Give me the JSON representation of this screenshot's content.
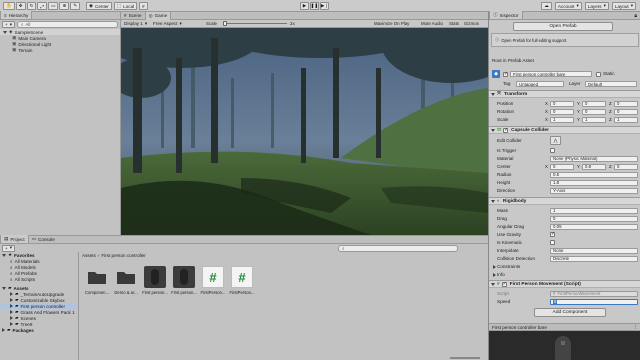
{
  "toolbar": {
    "pivot": "Center",
    "space": "Local",
    "account": "Account",
    "layers": "Layers",
    "layout": "Layout"
  },
  "hierarchy": {
    "tab": "Hierarchy",
    "search_placeholder": "All",
    "scene": "SampleScene",
    "items": [
      "Main Camera",
      "Directional Light",
      "Terrain"
    ]
  },
  "game": {
    "tabs": [
      "Scene",
      "Game"
    ],
    "display": "Display 1",
    "aspect": "Free Aspect",
    "scale_label": "Scale",
    "scale_value": "2x",
    "options": [
      "Maximize On Play",
      "Mute Audio",
      "Stats",
      "Gizmos"
    ]
  },
  "inspector": {
    "tab": "Inspector",
    "open_prefab": "Open Prefab",
    "open_prefab_hint": "Open Prefab for full editing support.",
    "root_label": "Root in Prefab Asset",
    "object_name": "First person controller bare",
    "static_label": "Static",
    "tag_label": "Tag",
    "tag_value": "Untagged",
    "layer_label": "Layer",
    "layer_value": "Default",
    "transform": {
      "title": "Transform",
      "rows": [
        {
          "label": "Position",
          "x": "0",
          "y": "0",
          "z": "0"
        },
        {
          "label": "Rotation",
          "x": "0",
          "y": "0",
          "z": "0"
        },
        {
          "label": "Scale",
          "x": "1",
          "y": "1",
          "z": "1"
        }
      ]
    },
    "capsule": {
      "title": "Capsule Collider",
      "edit_collider": "Edit Collider",
      "is_trigger": "Is Trigger",
      "material_label": "Material",
      "material_value": "None (Physic Material)",
      "center_label": "Center",
      "center": {
        "x": "0",
        "y": "0.9",
        "z": "0"
      },
      "radius_label": "Radius",
      "radius": "0.5",
      "height_label": "Height",
      "height": "1.8",
      "direction_label": "Direction",
      "direction": "Y-Axis"
    },
    "rigidbody": {
      "title": "Rigidbody",
      "mass_label": "Mass",
      "mass": "1",
      "drag_label": "Drag",
      "drag": "0",
      "angular_label": "Angular Drag",
      "angular": "0.05",
      "gravity_label": "Use Gravity",
      "kinematic_label": "Is Kinematic",
      "interpolate_label": "Interpolate",
      "interpolate": "None",
      "collision_label": "Collision Detection",
      "collision": "Discrete",
      "constraints": "Constraints",
      "info": "Info"
    },
    "movement": {
      "title": "First Person Movement (Script)",
      "script_label": "Script",
      "script_value": "FirstPersonMovement",
      "speed_label": "Speed",
      "speed_value": "5"
    },
    "add_component": "Add Component",
    "preview_title": "First person controller bare"
  },
  "project": {
    "tabs": [
      "Project",
      "Console"
    ],
    "breadcrumb": [
      "Assets",
      "First person controller"
    ],
    "favorites_label": "Favorites",
    "favorites": [
      "All Materials",
      "All Models",
      "All Prefabs",
      "All Scripts"
    ],
    "assets_label": "Assets",
    "folders": [
      "_TerrainAutoUpgrade",
      "Customizable Skybox",
      "First person controller",
      "Grass And Flowers Pack 1",
      "Scenes",
      "Tree9"
    ],
    "packages_label": "Packages",
    "items": [
      {
        "name": "Componen...",
        "kind": "folder"
      },
      {
        "name": "Demo & ar...",
        "kind": "folder"
      },
      {
        "name": "First person...",
        "kind": "capsule"
      },
      {
        "name": "First person...",
        "kind": "capsule"
      },
      {
        "name": "FirstPerson...",
        "kind": "script"
      },
      {
        "name": "FirstPerson...",
        "kind": "script"
      }
    ]
  }
}
